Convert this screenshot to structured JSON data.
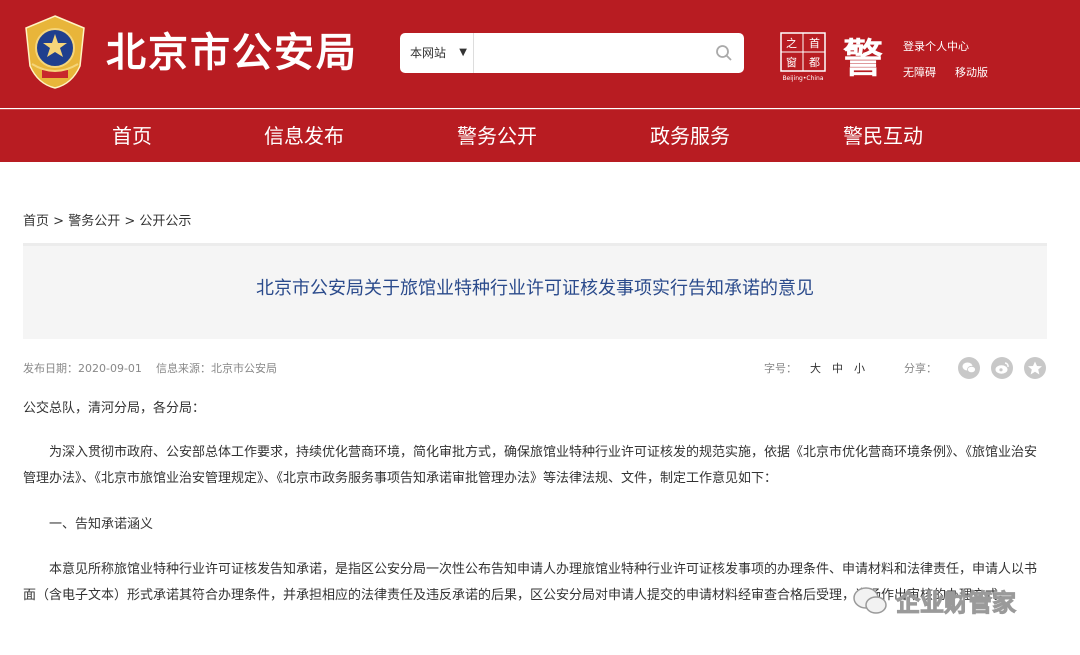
{
  "header": {
    "site_title": "北京市公安局",
    "search": {
      "scope": "本网站",
      "placeholder": ""
    },
    "logo_capital_caption": "Beijing•China",
    "logo_capital_chars": [
      "首",
      "都",
      "之",
      "窗"
    ],
    "logo_police_char": "警",
    "tools": {
      "login": "登录个人中心",
      "accessibility": "无障碍",
      "mobile": "移动版"
    }
  },
  "nav": {
    "items": [
      "首页",
      "信息发布",
      "警务公开",
      "政务服务",
      "警民互动"
    ]
  },
  "breadcrumb": {
    "home": "首页",
    "sep1": " > ",
    "level2": "警务公开",
    "sep2": " > ",
    "level3": "公开公示"
  },
  "article": {
    "title": "北京市公安局关于旅馆业特种行业许可证核发事项实行告知承诺的意见",
    "publish_date": "发布日期：2020-09-01",
    "source": "信息来源：北京市公安局",
    "font_size_label": "字号：",
    "font_sizes": [
      "大",
      "中",
      "小"
    ],
    "share_label": "分享：",
    "share_icons": [
      "wechat-icon",
      "weibo-icon",
      "favorite-star-icon"
    ],
    "greeting": "公交总队，清河分局，各分局：",
    "intro": "为深入贯彻市政府、公安部总体工作要求，持续优化营商环境，简化审批方式，确保旅馆业特种行业许可证核发的规范实施，依据《北京市优化营商环境条例》、《旅馆业治安管理办法》、《北京市旅馆业治安管理规定》、《北京市政务服务事项告知承诺审批管理办法》等法律法规、文件，制定工作意见如下：",
    "section1_heading": "一、告知承诺涵义",
    "section1_text": "本意见所称旅馆业特种行业许可证核发告知承诺，是指区公安分局一次性公布告知申请人办理旅馆业特种行业许可证核发事项的办理条件、申请材料和法律责任，申请人以书面（含电子文本）形式承诺其符合办理条件，并承担相应的法律责任及违反承诺的后果，区公安分局对申请人提交的申请材料经审查合格后受理，当场作出审核的办理方式。"
  },
  "watermark": {
    "text": "企业财管家"
  },
  "colors": {
    "brand_red": "#b81c22",
    "title_blue": "#2b4b8c",
    "meta_gray": "#888888"
  }
}
